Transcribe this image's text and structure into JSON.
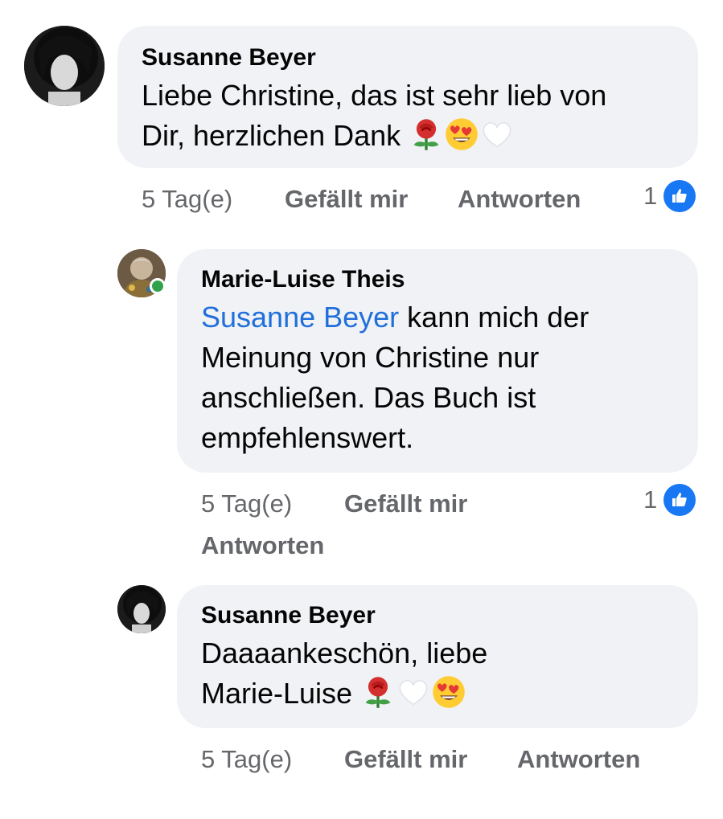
{
  "comments": [
    {
      "author": "Susanne Beyer",
      "text_line1": "Liebe Christine, das ist sehr lieb von",
      "text_line2": "Dir, herzlichen Dank",
      "emojis": [
        "rose-emoji",
        "heart-eyes-emoji",
        "white-heart-emoji"
      ],
      "time": "5 Tag(e)",
      "like_label": "Gefällt mir",
      "reply_label": "Antworten",
      "reaction_count": "1",
      "reaction_icon": "like-icon"
    },
    {
      "author": "Marie-Luise Theis",
      "mention": "Susanne Beyer",
      "text_line1": " kann mich der",
      "text_line2": "Meinung von Christine nur",
      "text_line3": "anschließen. Das Buch ist",
      "text_line4": "empfehlenswert.",
      "time": "5 Tag(e)",
      "like_label": "Gefällt mir",
      "reply_label": "Antworten",
      "reaction_count": "1",
      "reaction_icon": "like-icon",
      "online": true
    },
    {
      "author": "Susanne Beyer",
      "text_line1": "Daaaankeschön, liebe",
      "text_line2": "Marie-Luise",
      "emojis": [
        "rose-emoji",
        "white-heart-emoji",
        "heart-eyes-emoji"
      ],
      "time": "5 Tag(e)",
      "like_label": "Gefällt mir",
      "reply_label": "Antworten"
    }
  ],
  "colors": {
    "bubble": "#f0f2f5",
    "mention": "#216fdb",
    "meta": "#65676b",
    "like": "#1877f2",
    "online": "#31a24c"
  }
}
